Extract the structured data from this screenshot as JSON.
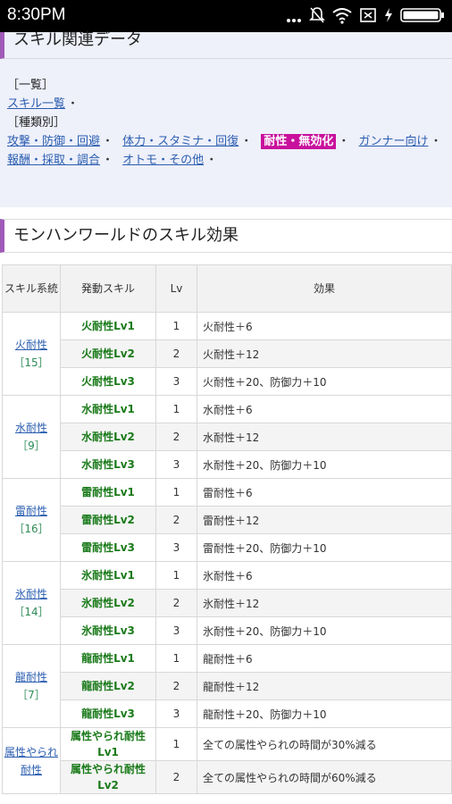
{
  "status_bar": {
    "time": "8:30PM",
    "icons": [
      "signal-dots-icon",
      "mute-bell-icon",
      "wifi-icon",
      "sim-x-icon",
      "charging-icon",
      "battery-icon"
    ]
  },
  "related": {
    "heading": "スキル関連データ",
    "list_label": "［一覧］",
    "list_links": [
      "スキル一覧"
    ],
    "category_label": "［種類別］",
    "row1": [
      "攻撃・防御・回避",
      "体力・スタミナ・回復",
      "耐性・無効化",
      "ガンナー向け"
    ],
    "row2": [
      "報酬・採取・調合",
      "オトモ・その他"
    ],
    "active_category": "耐性・無効化",
    "separator": "・"
  },
  "section_title": "モンハンワールドのスキル効果",
  "table": {
    "headers": {
      "group": "スキル系統",
      "skill": "発動スキル",
      "lv": "Lv",
      "effect": "効果"
    },
    "groups": [
      {
        "name": "火耐性",
        "count": "［15］",
        "rows": [
          {
            "skill": "火耐性Lv1",
            "lv": "1",
            "effect": "火耐性＋6"
          },
          {
            "skill": "火耐性Lv2",
            "lv": "2",
            "effect": "火耐性＋12"
          },
          {
            "skill": "火耐性Lv3",
            "lv": "3",
            "effect": "火耐性＋20、防御力＋10"
          }
        ]
      },
      {
        "name": "水耐性",
        "count": "［9］",
        "rows": [
          {
            "skill": "水耐性Lv1",
            "lv": "1",
            "effect": "水耐性＋6"
          },
          {
            "skill": "水耐性Lv2",
            "lv": "2",
            "effect": "水耐性＋12"
          },
          {
            "skill": "水耐性Lv3",
            "lv": "3",
            "effect": "水耐性＋20、防御力＋10"
          }
        ]
      },
      {
        "name": "雷耐性",
        "count": "［16］",
        "rows": [
          {
            "skill": "雷耐性Lv1",
            "lv": "1",
            "effect": "雷耐性＋6"
          },
          {
            "skill": "雷耐性Lv2",
            "lv": "2",
            "effect": "雷耐性＋12"
          },
          {
            "skill": "雷耐性Lv3",
            "lv": "3",
            "effect": "雷耐性＋20、防御力＋10"
          }
        ]
      },
      {
        "name": "氷耐性",
        "count": "［14］",
        "rows": [
          {
            "skill": "氷耐性Lv1",
            "lv": "1",
            "effect": "氷耐性＋6"
          },
          {
            "skill": "氷耐性Lv2",
            "lv": "2",
            "effect": "氷耐性＋12"
          },
          {
            "skill": "氷耐性Lv3",
            "lv": "3",
            "effect": "氷耐性＋20、防御力＋10"
          }
        ]
      },
      {
        "name": "龍耐性",
        "count": "［7］",
        "rows": [
          {
            "skill": "龍耐性Lv1",
            "lv": "1",
            "effect": "龍耐性＋6"
          },
          {
            "skill": "龍耐性Lv2",
            "lv": "2",
            "effect": "龍耐性＋12"
          },
          {
            "skill": "龍耐性Lv3",
            "lv": "3",
            "effect": "龍耐性＋20、防御力＋10"
          }
        ]
      },
      {
        "name": "属性やられ耐性",
        "count": "",
        "rows": [
          {
            "skill": "属性やられ耐性Lv1",
            "lv": "1",
            "effect": "全ての属性やられの時間が30%減る"
          },
          {
            "skill": "属性やられ耐性Lv2",
            "lv": "2",
            "effect": "全ての属性やられの時間が60%減る"
          }
        ]
      }
    ]
  },
  "colors": {
    "accent_bar": "#a05ab8",
    "active_badge": "#c8109c",
    "link": "#2a5db0",
    "skill_text": "#1a7a1a",
    "count_text": "#2e8b57",
    "related_bg": "#eef0fa"
  }
}
